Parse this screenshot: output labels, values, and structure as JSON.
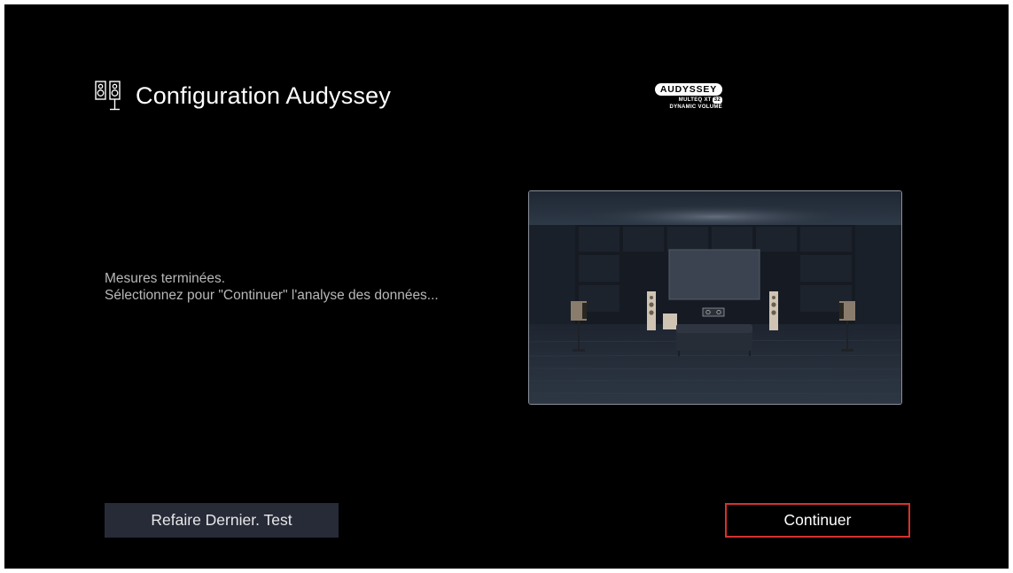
{
  "header": {
    "title": "Configuration Audyssey",
    "icon": "speakers-icon"
  },
  "logo": {
    "brand": "AUDYSSEY",
    "line1": "MULTEQ XT",
    "line1_badge": "32",
    "line2": "DYNAMIC VOLUME"
  },
  "message": {
    "line1": "Mesures terminées.",
    "line2": "Sélectionnez pour \"Continuer\" l'analyse des données..."
  },
  "buttons": {
    "retest_label": "Refaire Dernier. Test",
    "continue_label": "Continuer"
  },
  "colors": {
    "background": "#000000",
    "button_fill": "#272b38",
    "focus_border": "#d6322e"
  }
}
